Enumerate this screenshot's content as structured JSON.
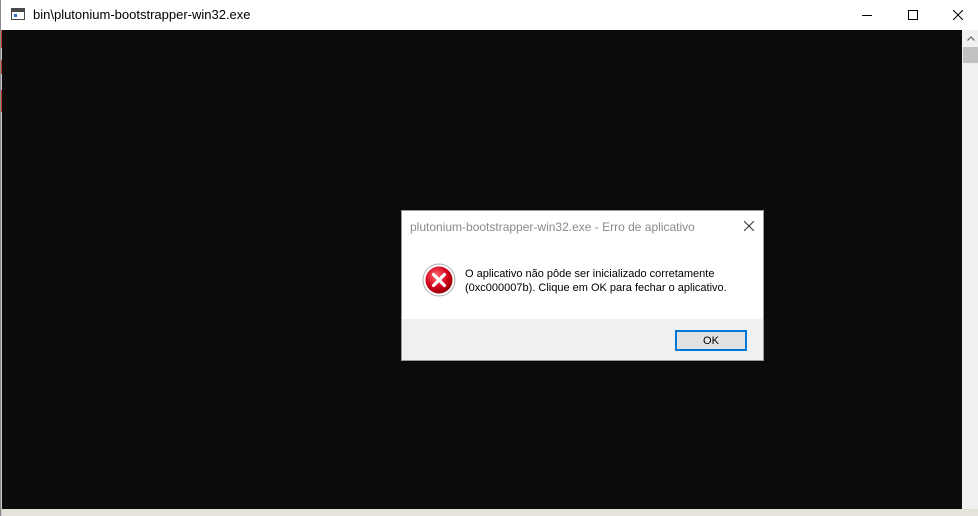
{
  "window": {
    "title": "bin\\plutonium-bootstrapper-win32.exe",
    "app_icon": "console-window-icon",
    "controls": {
      "minimize_icon": "minimize-icon",
      "maximize_icon": "maximize-icon",
      "close_icon": "close-icon"
    }
  },
  "console": {
    "background": "#0c0c0c"
  },
  "dialog": {
    "title": "plutonium-bootstrapper-win32.exe - Erro de aplicativo",
    "icon": "error-icon",
    "message_line1": "O aplicativo não pôde ser inicializado corretamente",
    "message_line2": "(0xc000007b). Clique em OK para fechar o aplicativo.",
    "ok_label": "OK",
    "accent_color": "#0078d7",
    "error_color": "#d0021b"
  }
}
